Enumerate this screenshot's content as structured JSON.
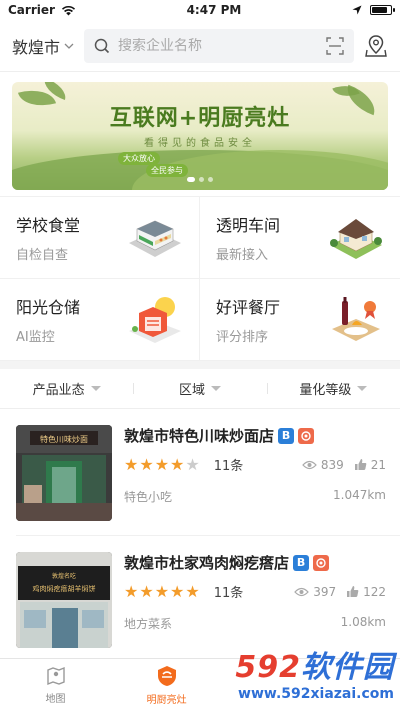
{
  "status": {
    "carrier": "Carrier",
    "time": "4:47 PM",
    "battery_level": 0.9
  },
  "header": {
    "city": "敦煌市",
    "search_placeholder": "搜索企业名称"
  },
  "banner": {
    "title": "互联网+明厨亮灶",
    "subtitle": "看得见的食品安全",
    "tags": [
      "大众放心",
      "全民参与"
    ]
  },
  "grid": [
    {
      "title": "学校食堂",
      "subtitle": "自检自查",
      "icon": "school-canteen-icon"
    },
    {
      "title": "透明车间",
      "subtitle": "最新接入",
      "icon": "workshop-icon"
    },
    {
      "title": "阳光仓储",
      "subtitle": "AI监控",
      "icon": "warehouse-icon"
    },
    {
      "title": "好评餐厅",
      "subtitle": "评分排序",
      "icon": "restaurant-icon"
    }
  ],
  "filters": [
    "产品业态",
    "区域",
    "量化等级"
  ],
  "restaurants": [
    {
      "name": "敦煌市特色川味炒面店",
      "badges": [
        "B"
      ],
      "rating": 4,
      "reviews": "11条",
      "views": "839",
      "likes": "21",
      "category": "特色小吃",
      "distance": "1.047km",
      "sign_text": "特色川味炒面"
    },
    {
      "name": "敦煌市杜家鸡肉焖疙瘩店",
      "badges": [
        "B"
      ],
      "rating": 5,
      "reviews": "11条",
      "views": "397",
      "likes": "122",
      "category": "地方菜系",
      "distance": "1.08km",
      "sign_text": "敦煌名吃 鸡肉焖疙瘩胡羊焖饼"
    }
  ],
  "tabbar": [
    {
      "label": "地图",
      "icon": "map-icon",
      "active": false
    },
    {
      "label": "明厨亮灶",
      "icon": "kitchen-icon",
      "active": true
    }
  ],
  "watermark": {
    "brand_num": "592",
    "brand_text": "软件园",
    "url": "www.592xiazai.com"
  },
  "colors": {
    "accent": "#f36b1c",
    "star": "#f39c2b",
    "badge_blue": "#2b7fd8",
    "badge_orange": "#ee6a4a"
  }
}
